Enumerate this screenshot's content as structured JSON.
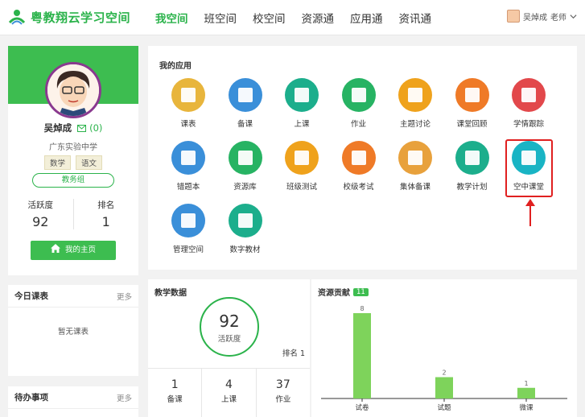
{
  "header": {
    "logo_text": "粤教翔云学习空间",
    "nav": [
      {
        "label": "我空间",
        "active": true
      },
      {
        "label": "班空间",
        "active": false
      },
      {
        "label": "校空间",
        "active": false
      },
      {
        "label": "资源通",
        "active": false
      },
      {
        "label": "应用通",
        "active": false
      },
      {
        "label": "资讯通",
        "active": false
      }
    ],
    "user_name": "吴焯成",
    "user_role": "老师"
  },
  "profile": {
    "name": "吴焯成",
    "message_count": "(0)",
    "school": "广东实验中学",
    "tags": [
      "数学",
      "语文"
    ],
    "group": "教务组",
    "activity_label": "活跃度",
    "activity_value": "92",
    "rank_label": "排名",
    "rank_value": "1",
    "home_button": "我的主页"
  },
  "today": {
    "title": "今日课表",
    "more": "更多",
    "empty": "暂无课表"
  },
  "todo": {
    "title": "待办事项",
    "more": "更多"
  },
  "apps": {
    "title": "我的应用",
    "items": [
      {
        "label": "课表",
        "icon": "table-icon",
        "color": "#e8b53c"
      },
      {
        "label": "备课",
        "icon": "prep-icon",
        "color": "#3a8fd9"
      },
      {
        "label": "上课",
        "icon": "teach-icon",
        "color": "#1cae8c"
      },
      {
        "label": "作业",
        "icon": "homework-icon",
        "color": "#27b363"
      },
      {
        "label": "主题讨论",
        "icon": "discussion-icon",
        "color": "#efa21c"
      },
      {
        "label": "课堂回顾",
        "icon": "review-icon",
        "color": "#ef7a27"
      },
      {
        "label": "学情跟踪",
        "icon": "tracking-icon",
        "color": "#e2484b"
      },
      {
        "label": "错题本",
        "icon": "book-icon",
        "color": "#3a8fd9"
      },
      {
        "label": "资源库",
        "icon": "library-icon",
        "color": "#27b363"
      },
      {
        "label": "班级测试",
        "icon": "class-test-icon",
        "color": "#efa21c"
      },
      {
        "label": "校级考试",
        "icon": "school-exam-icon",
        "color": "#ef7a27"
      },
      {
        "label": "集体备课",
        "icon": "group-prep-icon",
        "color": "#e8a13c"
      },
      {
        "label": "教学计划",
        "icon": "plan-icon",
        "color": "#1cae8c"
      },
      {
        "label": "空中课堂",
        "icon": "air-class-icon",
        "color": "#19b4c4"
      },
      {
        "label": "管理空间",
        "icon": "home-icon",
        "color": "#3a8fd9"
      },
      {
        "label": "数字教材",
        "icon": "digital-textbook-icon",
        "color": "#1cae8c"
      }
    ]
  },
  "teaching": {
    "title": "教学数据",
    "activity_value": "92",
    "activity_label": "活跃度",
    "rank": "排名 1",
    "counts": [
      {
        "value": "1",
        "label": "备课"
      },
      {
        "value": "4",
        "label": "上课"
      },
      {
        "value": "37",
        "label": "作业"
      }
    ]
  },
  "resources": {
    "title": "资源贡献",
    "badge": "11"
  },
  "chart_data": {
    "type": "bar",
    "categories": [
      "试卷",
      "试题",
      "微课"
    ],
    "values": [
      8,
      2,
      1
    ],
    "ylim": [
      0,
      8
    ],
    "color": "#7ed35b",
    "grid": false
  }
}
